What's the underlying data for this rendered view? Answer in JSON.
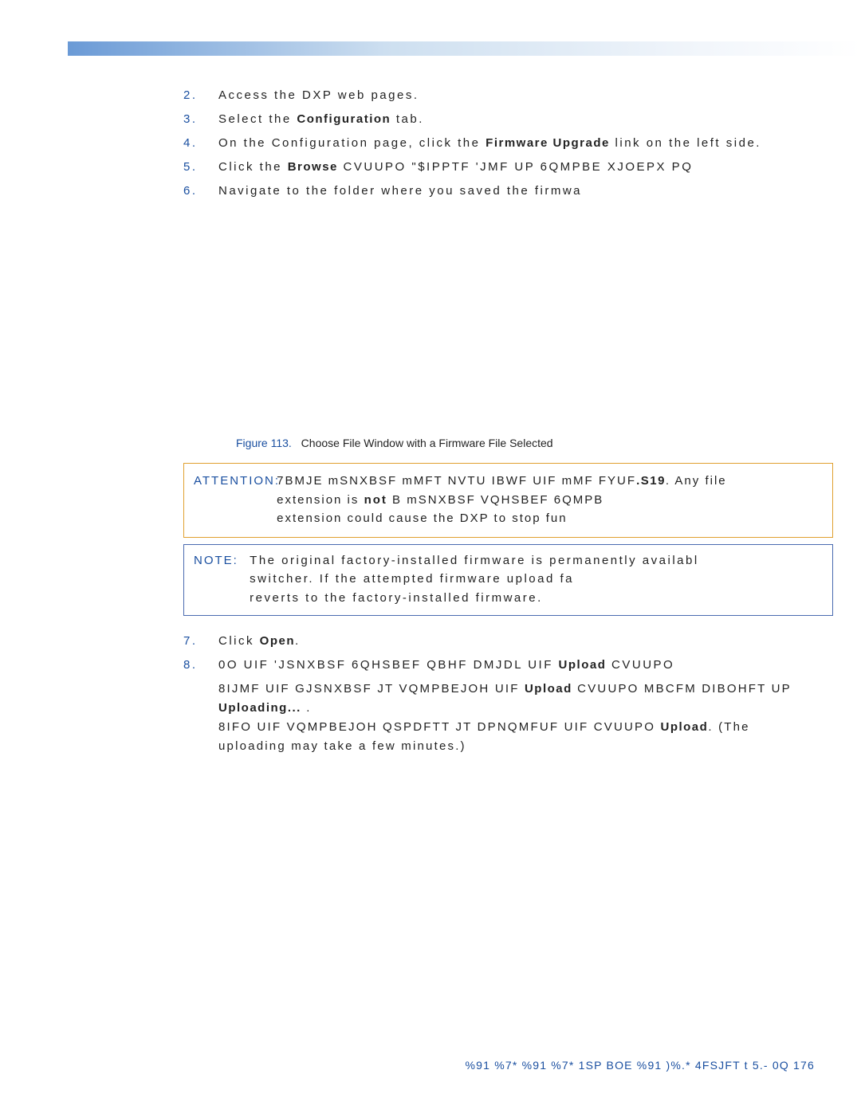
{
  "steps": {
    "s2": {
      "num": "2.",
      "text": "Access the DXP web pages."
    },
    "s3": {
      "num": "3.",
      "pre": "Select the ",
      "bold": "Configuration",
      "post": " tab."
    },
    "s4": {
      "num": "4.",
      "pre": "On the Configuration page, click the ",
      "bold": "Firmware Upgrade",
      "post": " link on the left side."
    },
    "s5": {
      "num": "5.",
      "pre": "Click the ",
      "bold": "Browse",
      "post": " CVUUPO  \"$IPPTF 'JMF UP 6QMPBE XJOEPX PQ"
    },
    "s6": {
      "num": "6.",
      "text": "Navigate to the folder where you saved the firmwa"
    },
    "s7": {
      "num": "7.",
      "pre": "Click ",
      "bold": "Open",
      "post": "."
    },
    "s8": {
      "num": "8.",
      "pre": "0O UIF 'JSNXBSF 6QHSBEF QBHF DMJDL UIF ",
      "bold": "Upload",
      "post": " CVUUPO"
    }
  },
  "figure": {
    "label": "Figure 113.",
    "caption": "Choose File Window with a Firmware File Selected"
  },
  "attention": {
    "label": "ATTENTION:",
    "line1a": "7BMJE mSNXBSF mMFT NVTU IBWF UIF mMF FYUF",
    "line1b": ".S19",
    "line1c": ". Any file",
    "line2a": "extension is ",
    "line2b": "not",
    "line2c": " B mSNXBSF VQHSBEF  6QMPB",
    "line3": "extension could cause the DXP to stop fun"
  },
  "note": {
    "label": "NOTE:",
    "line1": "The original factory-installed firmware is permanently availabl",
    "line2": "switcher. If the attempted firmware upload fa",
    "line3": "reverts to the factory-installed firmware."
  },
  "step8body": {
    "line1a": "8IJMF UIF GJSNXBSF JT VQMPBEJOH UIF ",
    "line1b": "Upload",
    "line1c": " CVUUPO MBCFM DIBOHFT UP ",
    "line1d": "Uploading...",
    "line1e": " .",
    "line2a": "8IFO UIF VQMPBEJOH QSPDFTT JT DPNQMFUF UIF CVUUPO",
    "line2b": "Upload",
    "line2c": ". (The",
    "line3": "uploading may take a few minutes.)"
  },
  "footer": "%91 %7*  %91 %7* 1SP  BOE %91 )%.* 4FSJFT t 5.- 0Q      176"
}
